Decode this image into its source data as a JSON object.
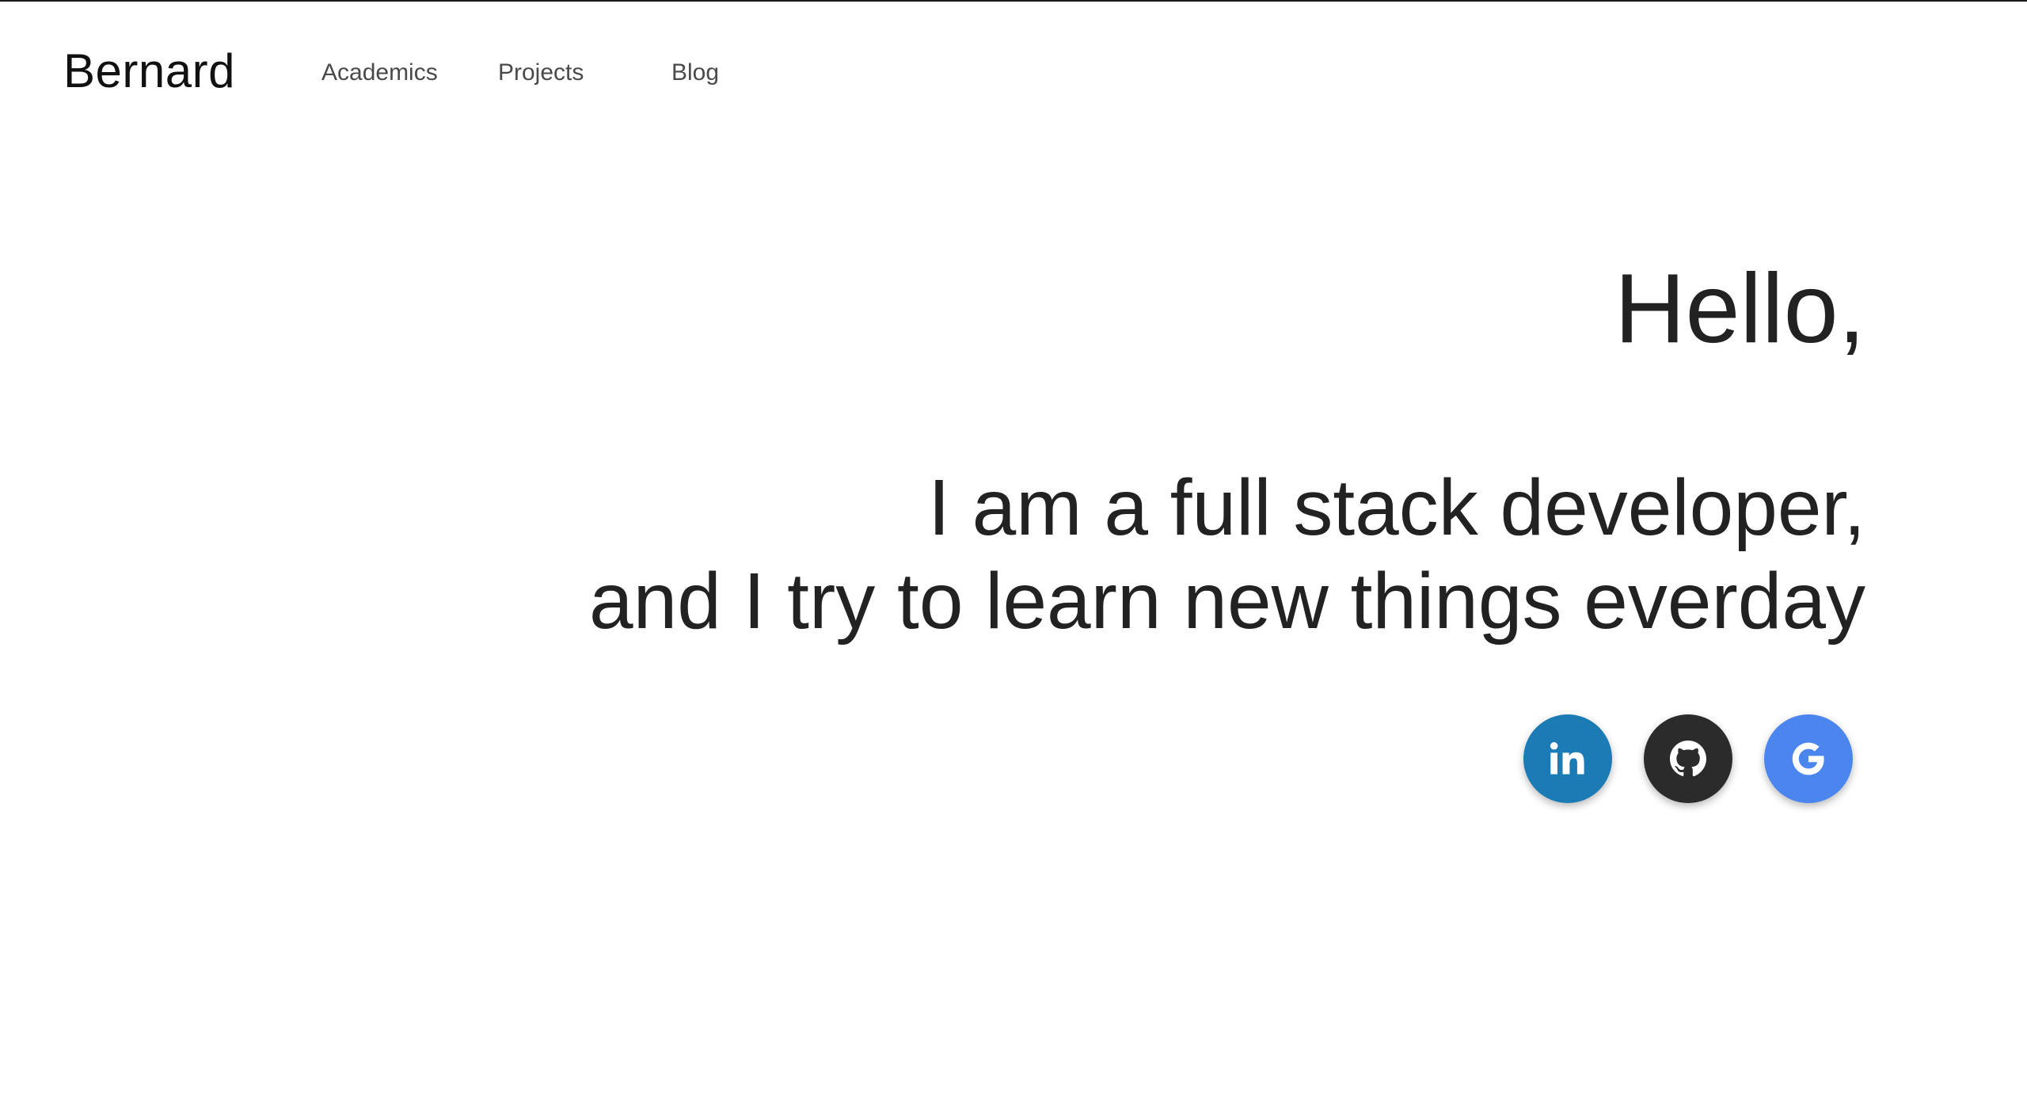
{
  "navbar": {
    "brand": "Bernard",
    "links": [
      {
        "label": "Academics"
      },
      {
        "label": "Projects"
      },
      {
        "label": "Blog"
      }
    ]
  },
  "hero": {
    "greeting": "Hello,",
    "tagline_line1": "I am a full stack developer,",
    "tagline_line2": "and I try to learn new things everday"
  },
  "socials": [
    {
      "name": "linkedin-icon",
      "color": "#1a7bb5"
    },
    {
      "name": "github-icon",
      "color": "#2b2b2b"
    },
    {
      "name": "google-icon",
      "color": "#4a86ee"
    }
  ],
  "colors": {
    "text": "#222222",
    "nav_text": "#4a4a4a",
    "background": "#ffffff"
  }
}
